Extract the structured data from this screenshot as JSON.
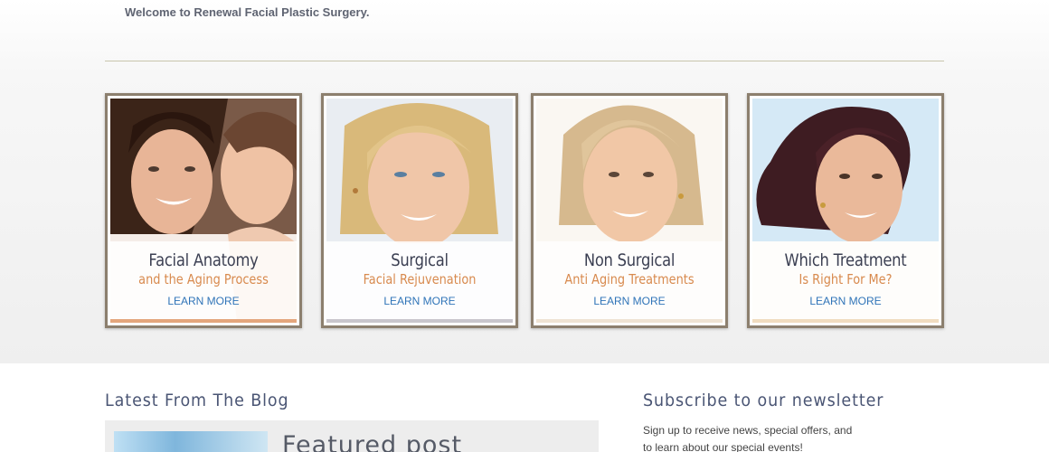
{
  "header": {
    "welcome_text": "Welcome to Renewal Facial Plastic Surgery."
  },
  "cards": [
    {
      "title": "Facial Anatomy",
      "subtitle": "and the Aging Process",
      "link": "LEARN MORE",
      "photo_icon": "mother-daughter-photo",
      "accent": "#e4a67c"
    },
    {
      "title": "Surgical",
      "subtitle": "Facial Rejuvenation",
      "link": "LEARN MORE",
      "photo_icon": "blonde-woman-photo",
      "accent": "#c9c6cc"
    },
    {
      "title": "Non Surgical",
      "subtitle": "Anti Aging Treatments",
      "link": "LEARN MORE",
      "photo_icon": "mature-woman-photo",
      "accent": "#efe3d3"
    },
    {
      "title": "Which Treatment",
      "subtitle": "Is Right For Me?",
      "link": "LEARN MORE",
      "photo_icon": "dark-haired-woman-photo",
      "accent": "#f0dcc0"
    }
  ],
  "blog": {
    "heading": "Latest From The Blog",
    "featured_title": "Featured post"
  },
  "newsletter": {
    "heading": "Subscribe to our newsletter",
    "text_line1": "Sign up to receive news, special offers, and",
    "text_line2": "to learn about our special events!"
  },
  "colors": {
    "card_border": "#8c7f6e",
    "title_text": "#3b3f52",
    "subtitle_orange": "#d88a4e",
    "link_blue": "#2f74b8",
    "section_heading": "#4a5574"
  }
}
